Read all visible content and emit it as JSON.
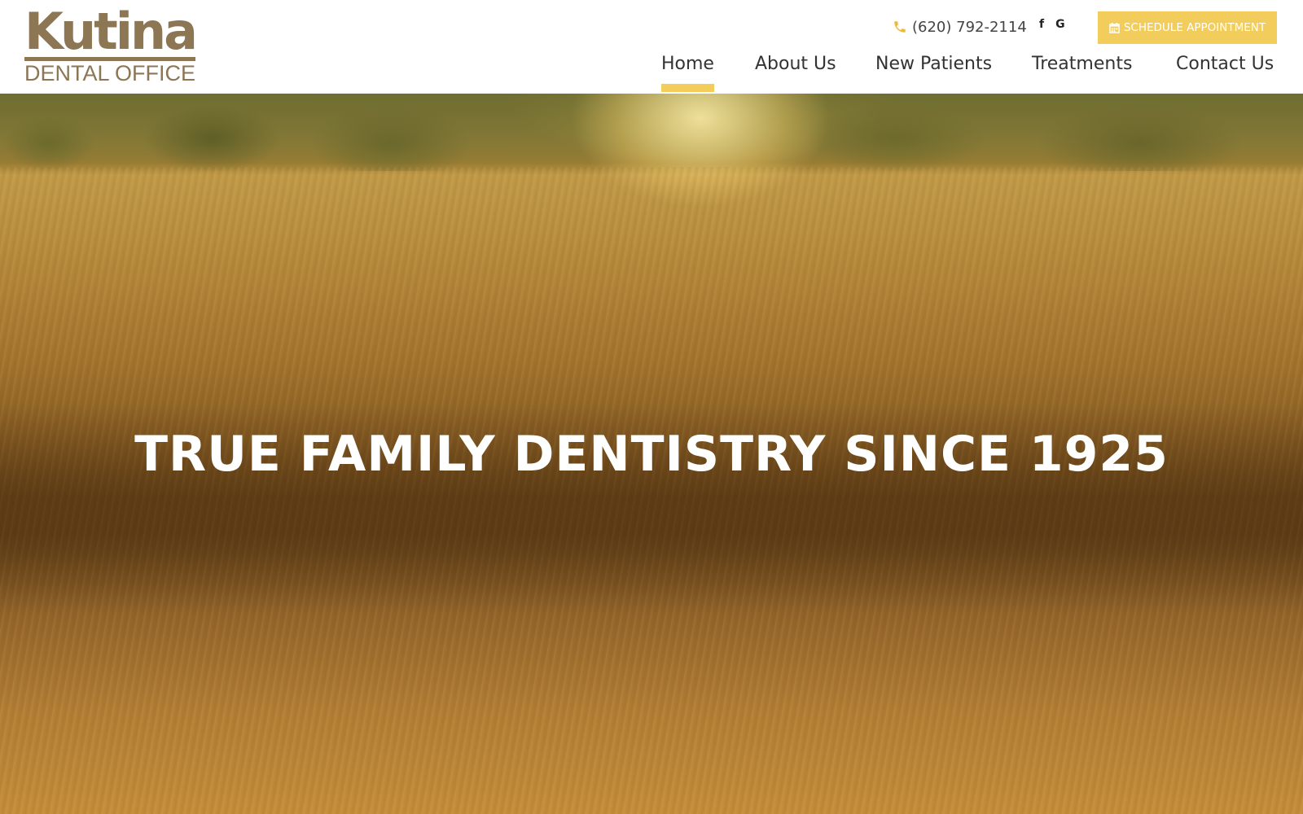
{
  "logo": {
    "name": "Kutina",
    "subtitle": "DENTAL OFFICE"
  },
  "header": {
    "phone": "(620) 792-2114",
    "social": {
      "facebook": "f",
      "google": "G"
    },
    "schedule_label": "SCHEDULE APPOINTMENT",
    "icons": {
      "phone": "phone-icon",
      "schedule": "calendar-icon"
    }
  },
  "nav": {
    "items": [
      {
        "label": "Home",
        "active": true
      },
      {
        "label": "About Us"
      },
      {
        "label": "New Patients"
      },
      {
        "label": "Treatments"
      },
      {
        "label": "Contact Us"
      }
    ]
  },
  "hero": {
    "title": "TRUE FAMILY DENTISTRY SINCE 1925"
  },
  "colors": {
    "brand": "#8c7654",
    "accent": "#f2cd5c",
    "phone_icon": "#f2b63a"
  }
}
